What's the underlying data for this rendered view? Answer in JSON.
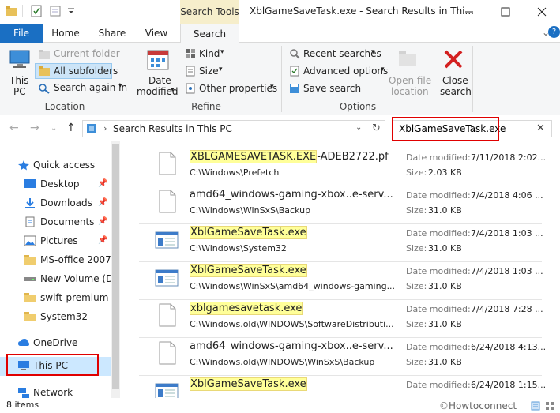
{
  "window": {
    "title": "XblGameSaveTask.exe - Search Results in Thi...",
    "context_tab": "Search Tools"
  },
  "tabs": [
    {
      "label": "File"
    },
    {
      "label": "Home"
    },
    {
      "label": "Share"
    },
    {
      "label": "View"
    },
    {
      "label": "Search"
    }
  ],
  "ribbon": {
    "location": {
      "label": "Location",
      "this_pc_line1": "This",
      "this_pc_line2": "PC",
      "current_folder": "Current folder",
      "all_subfolders": "All subfolders",
      "search_again": "Search again in"
    },
    "refine": {
      "label": "Refine",
      "date_modified_line1": "Date",
      "date_modified_line2": "modified",
      "kind": "Kind",
      "size": "Size",
      "other_properties": "Other properties"
    },
    "options": {
      "label": "Options",
      "recent_searches": "Recent searches",
      "advanced_options": "Advanced options",
      "save_search": "Save search",
      "open_file_location_line1": "Open file",
      "open_file_location_line2": "location",
      "close_search_line1": "Close",
      "close_search_line2": "search"
    }
  },
  "address": {
    "path": "Search Results in This PC",
    "search_value": "XblGameSaveTask.exe"
  },
  "nav": {
    "items": [
      {
        "label": "Quick access",
        "icon": "star-icon"
      },
      {
        "label": "Desktop",
        "icon": "desktop-icon"
      },
      {
        "label": "Downloads",
        "icon": "download-icon"
      },
      {
        "label": "Documents",
        "icon": "documents-icon"
      },
      {
        "label": "Pictures",
        "icon": "pictures-icon"
      },
      {
        "label": "MS-office 2007",
        "icon": "folder-icon"
      },
      {
        "label": "New Volume (D:",
        "icon": "drive-icon"
      },
      {
        "label": "swift-premium",
        "icon": "folder-icon"
      },
      {
        "label": "System32",
        "icon": "folder-icon"
      },
      {
        "label": "OneDrive",
        "icon": "cloud-icon"
      },
      {
        "label": "This PC",
        "icon": "computer-icon"
      },
      {
        "label": "Network",
        "icon": "network-icon"
      }
    ]
  },
  "results": {
    "modified_label": "Date modified:",
    "size_label": "Size:",
    "items": [
      {
        "name_hl": "XBLGAMESAVETASK.EXE",
        "name_rest": "-ADEB2722.pf",
        "path": "C:\\Windows\\Prefetch",
        "modified": "7/11/2018 2:02...",
        "size": "2.03 KB",
        "icon": "document-icon"
      },
      {
        "name_hl": "",
        "name_rest": "amd64_windows-gaming-xbox..e-serv...",
        "path": "C:\\Windows\\WinSxS\\Backup",
        "modified": "7/4/2018 4:06 ...",
        "size": "31.0 KB",
        "icon": "document-icon"
      },
      {
        "name_hl": "XblGameSaveTask.exe",
        "name_rest": "",
        "path": "C:\\Windows\\System32",
        "modified": "7/4/2018 1:03 ...",
        "size": "31.0 KB",
        "icon": "application-icon"
      },
      {
        "name_hl": "XblGameSaveTask.exe",
        "name_rest": "",
        "path": "C:\\Windows\\WinSxS\\amd64_windows-gaming...",
        "modified": "7/4/2018 1:03 ...",
        "size": "31.0 KB",
        "icon": "application-icon"
      },
      {
        "name_hl": "xblgamesavetask.exe",
        "name_rest": "",
        "path": "C:\\Windows.old\\WINDOWS\\SoftwareDistributi...",
        "modified": "7/4/2018 7:28 ...",
        "size": "31.0 KB",
        "icon": "document-icon"
      },
      {
        "name_hl": "",
        "name_rest": "amd64_windows-gaming-xbox..e-serv...",
        "path": "C:\\Windows.old\\WINDOWS\\WinSxS\\Backup",
        "modified": "6/24/2018 4:13...",
        "size": "31.0 KB",
        "icon": "document-icon"
      },
      {
        "name_hl": "XblGameSaveTask.exe",
        "name_rest": "",
        "path": "",
        "modified": "6/24/2018 1:15...",
        "size": "",
        "icon": "application-icon"
      }
    ]
  },
  "status": {
    "items_count": "8 items",
    "watermark": "©Howtoconnect"
  },
  "colors": {
    "accent": "#1a6fc3",
    "highlight": "#ffff99",
    "annotation_red": "#e00000",
    "context_tab": "#f6eecb"
  }
}
